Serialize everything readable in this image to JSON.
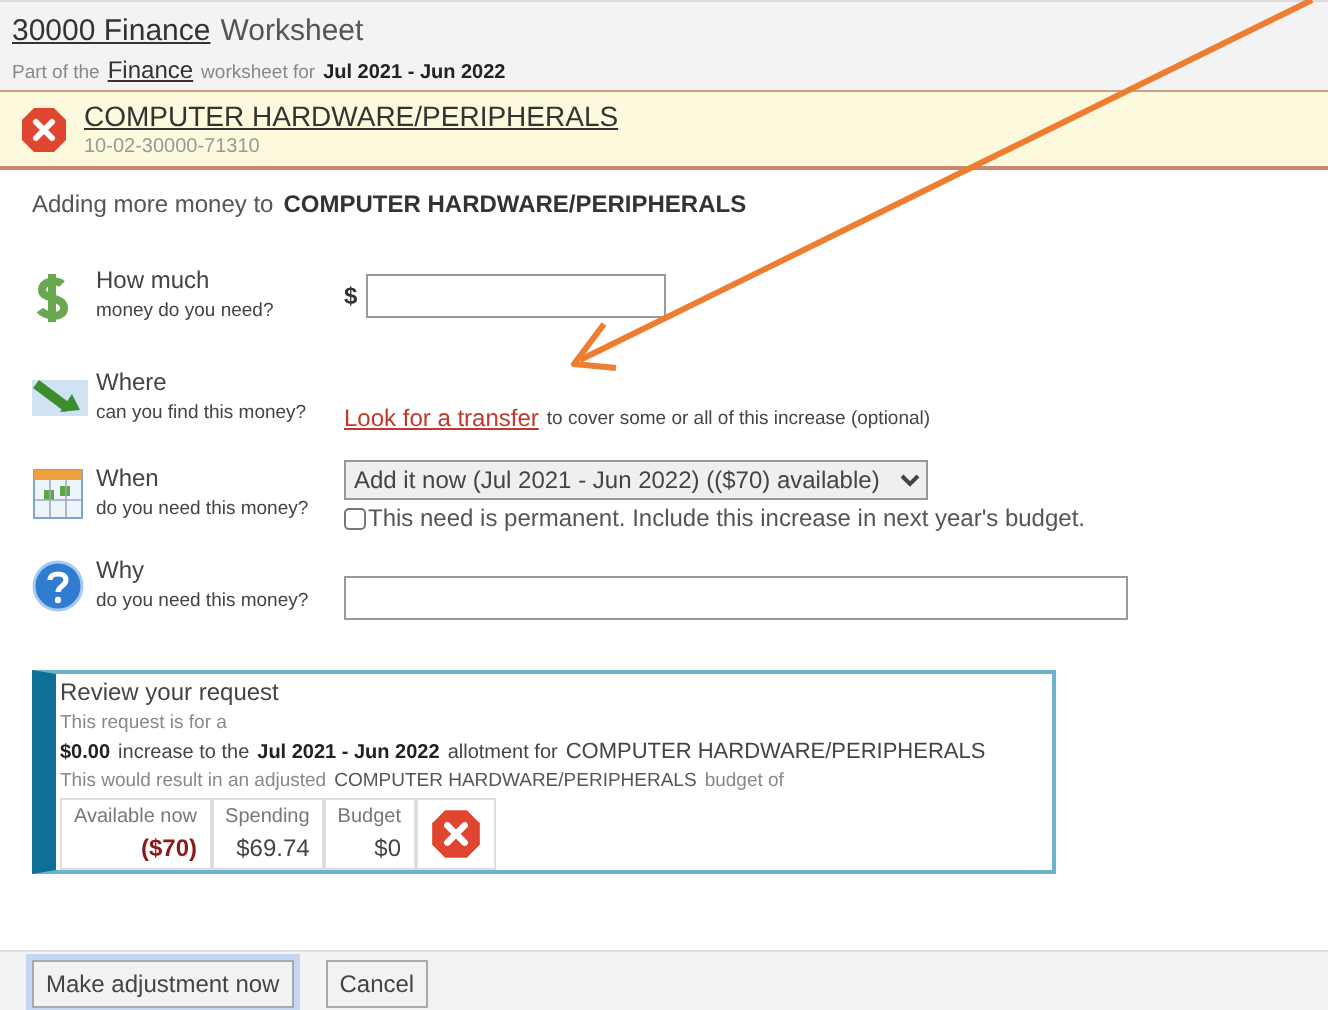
{
  "header": {
    "title_link": "30000 Finance",
    "title_rest": "Worksheet",
    "sub_prefix": "Part of the",
    "sub_link": "Finance",
    "sub_middle": "worksheet for",
    "period": "Jul 2021 - Jun 2022"
  },
  "account": {
    "name": "COMPUTER HARDWARE/PERIPHERALS",
    "code": "10-02-30000-71310",
    "valid": false
  },
  "intro": {
    "text": "Adding more money to",
    "target": "COMPUTER HARDWARE/PERIPHERALS"
  },
  "questions": [
    {
      "kind": "amount",
      "title": "How much",
      "subtitle": "money do you need?",
      "prefix": "$"
    },
    {
      "kind": "link",
      "title": "Where",
      "subtitle": "can you find this money?",
      "link": "Look for a transfer",
      "after": "to cover some or all of this increase (optional)"
    },
    {
      "kind": "select",
      "title": "When",
      "subtitle": "do you need this money?",
      "selected_option": "Add it now (Jul 2021 - Jun 2022) (($70) available)",
      "checkbox_label": "This need is permanent. Include this increase in next year's budget.",
      "checked": false
    },
    {
      "kind": "text",
      "title": "Why",
      "subtitle": "do you need this money?"
    }
  ],
  "review": {
    "title": "Review your request",
    "line1": "This request is for a",
    "amount": "$0.00",
    "increase_text": "increase to the",
    "period": "Jul 2021 - Jun 2022",
    "allotment_text": "allotment for",
    "account": "COMPUTER HARDWARE/PERIPHERALS",
    "result_prefix": "This would result in an adjusted",
    "result_account": "COMPUTER HARDWARE/PERIPHERALS",
    "result_suffix": "budget of",
    "figures": [
      {
        "label": "Available now",
        "value": "($70)",
        "negative": true
      },
      {
        "label": "Spending",
        "value": "$69.74",
        "negative": false
      },
      {
        "label": "Budget",
        "value": "$0",
        "negative": false
      }
    ],
    "valid": false
  },
  "buttons": [
    {
      "label": "Make adjustment now",
      "primary": true
    },
    {
      "label": "Cancel",
      "primary": false
    }
  ],
  "annotation": {
    "kind": "arrow",
    "color": "#ed7d31"
  }
}
